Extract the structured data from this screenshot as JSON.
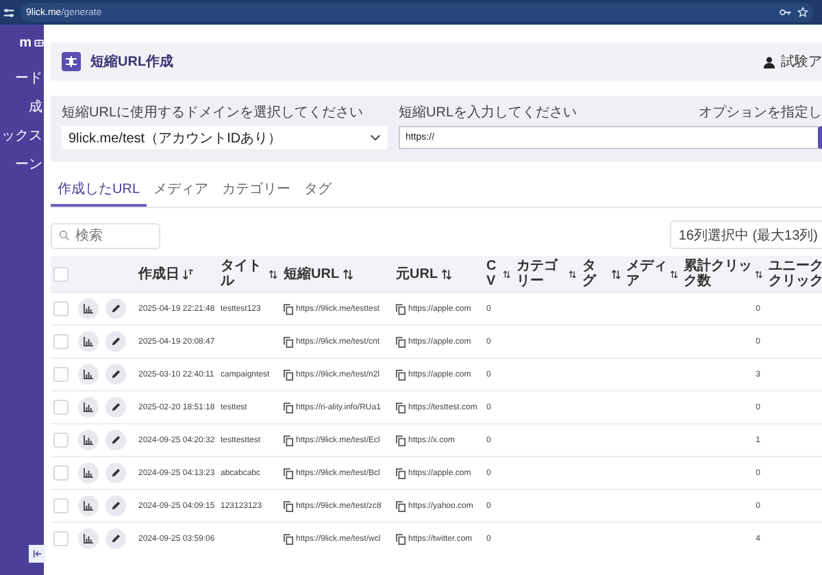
{
  "browser": {
    "host": "9lick.me",
    "path": "/generate"
  },
  "sidebar": {
    "brand": "m",
    "items": [
      {
        "label": "ード"
      },
      {
        "label": "成"
      },
      {
        "label": "ックス"
      },
      {
        "label": "ーン"
      }
    ]
  },
  "header": {
    "title": "短縮URL作成",
    "user": "試験ア"
  },
  "form": {
    "domain_label": "短縮URLに使用するドメインを選択してください",
    "domain_value": "9lick.me/test（アカウントIDあり）",
    "url_label": "短縮URLを入力してください",
    "url_value": "https://",
    "options_label": "オプションを指定し"
  },
  "tabs": [
    {
      "label": "作成したURL",
      "selected": true
    },
    {
      "label": "メディア",
      "selected": false
    },
    {
      "label": "カテゴリー",
      "selected": false
    },
    {
      "label": "タグ",
      "selected": false
    }
  ],
  "search": {
    "placeholder": "検索"
  },
  "column_picker": {
    "value": "16列選択中 (最大13列)"
  },
  "table": {
    "all_checked": false,
    "columns": [
      {
        "label": "作成日",
        "sorted": true
      },
      {
        "label": "タイトル",
        "sorted": false
      },
      {
        "label": "短縮URL",
        "sorted": false
      },
      {
        "label": "元URL",
        "sorted": false
      },
      {
        "label": "CV",
        "sorted": false
      },
      {
        "label": "カテゴリー",
        "sorted": false
      },
      {
        "label": "タグ",
        "sorted": false
      },
      {
        "label": "メディア",
        "sorted": false
      },
      {
        "label": "累計クリック数",
        "sorted": false
      },
      {
        "label": "ユニーククリック"
      }
    ],
    "rows": [
      {
        "checked": false,
        "created": "2025-04-19 22:21:48",
        "title": "testtest123",
        "short_url": "https://9lick.me/testtest",
        "original_url": "https://apple.com",
        "cv": "0",
        "total_clicks": "0"
      },
      {
        "checked": false,
        "created": "2025-04-19 20:08:47",
        "short_url": "https://9lick.me/test/cnt",
        "original_url": "https://apple.com",
        "cv": "0",
        "total_clicks": "0"
      },
      {
        "checked": false,
        "created": "2025-03-10 22:40:11",
        "title": "campaigntest",
        "short_url": "https://9lick.me/test/n2l",
        "original_url": "https://apple.com",
        "cv": "0",
        "total_clicks": "3"
      },
      {
        "checked": false,
        "created": "2025-02-20 18:51:18",
        "title": "testtest",
        "short_url": "https://ri-ality.info/RUa1",
        "original_url": "https://testtest.com",
        "cv": "0",
        "total_clicks": "0"
      },
      {
        "checked": false,
        "created": "2024-09-25 04:20:32",
        "title": "testtesttest",
        "short_url": "https://9lick.me/test/Ecl",
        "original_url": "https://x.com",
        "cv": "0",
        "total_clicks": "1"
      },
      {
        "checked": false,
        "created": "2024-09-25 04:13:23",
        "title": "abcabcabc",
        "short_url": "https://9lick.me/test/Bcl",
        "original_url": "https://apple.com",
        "cv": "0",
        "total_clicks": "0"
      },
      {
        "checked": false,
        "created": "2024-09-25 04:09:15",
        "title": "123123123",
        "short_url": "https://9lick.me/test/zc8",
        "original_url": "https://yahoo.com",
        "cv": "0",
        "total_clicks": "0"
      },
      {
        "checked": false,
        "created": "2024-09-25 03:59:06",
        "short_url": "https://9lick.me/test/wcl",
        "original_url": "https://twitter.com",
        "cv": "0",
        "total_clicks": "4"
      }
    ]
  }
}
